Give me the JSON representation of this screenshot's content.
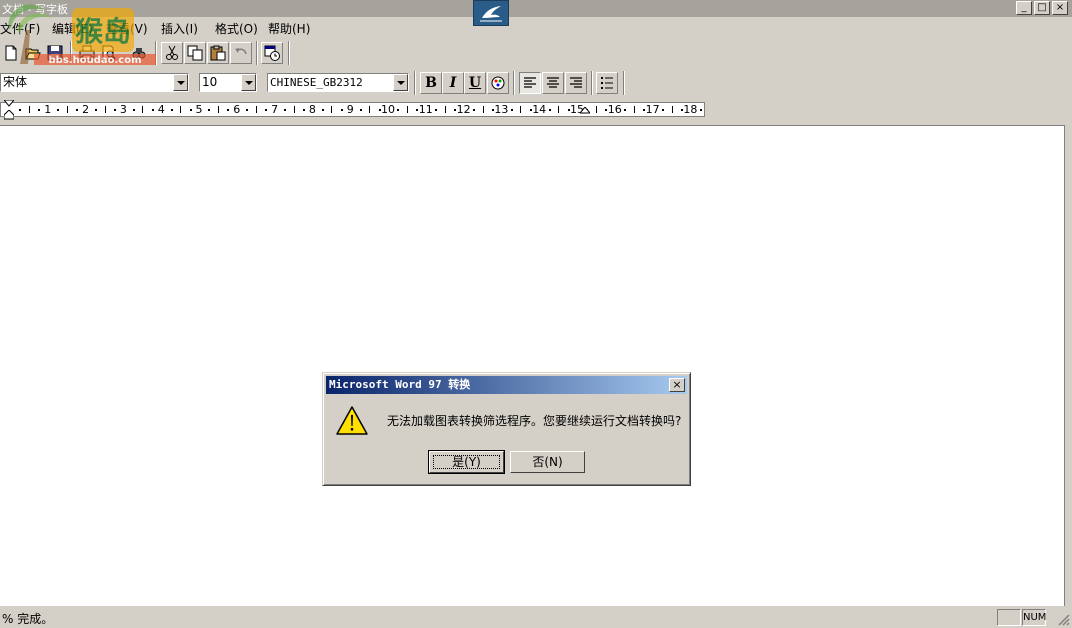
{
  "window": {
    "title": "文档 - 写字板",
    "controls": [
      "_",
      "□",
      "×"
    ]
  },
  "watermark": {
    "text": "bbs.houdao.com",
    "logo_text": "猴岛"
  },
  "menu": {
    "items": [
      {
        "label": "文件(F)"
      },
      {
        "label": "编辑(E)"
      },
      {
        "label": "查看(V)"
      },
      {
        "label": "插入(I)"
      },
      {
        "label": "格式(O)"
      },
      {
        "label": "帮助(H)"
      }
    ]
  },
  "toolbar": {
    "icons": [
      "new-icon",
      "open-icon",
      "save-icon",
      "print-icon",
      "print-preview-icon",
      "find-icon",
      "cut-icon",
      "copy-icon",
      "paste-icon",
      "undo-icon",
      "date-time-icon"
    ]
  },
  "format_bar": {
    "font_name": "宋体",
    "font_size": "10",
    "script": "CHINESE_GB2312",
    "bold_label": "B",
    "italic_label": "I",
    "underline_label": "U"
  },
  "ruler": {
    "numbers": [
      "1",
      "2",
      "3",
      "4",
      "5",
      "6",
      "7",
      "8",
      "9",
      "10",
      "11",
      "12",
      "13",
      "14",
      "15",
      "16",
      "17",
      "18"
    ]
  },
  "status": {
    "text": "% 完成。",
    "num": "NUM"
  },
  "dialog": {
    "title": "Microsoft Word 97 转换",
    "message": "无法加载图表转换筛选程序。您要继续运行文档转换吗?",
    "yes_label": "是(Y)",
    "no_label": "否(N)",
    "close_label": "×",
    "icon": "warning-icon"
  }
}
